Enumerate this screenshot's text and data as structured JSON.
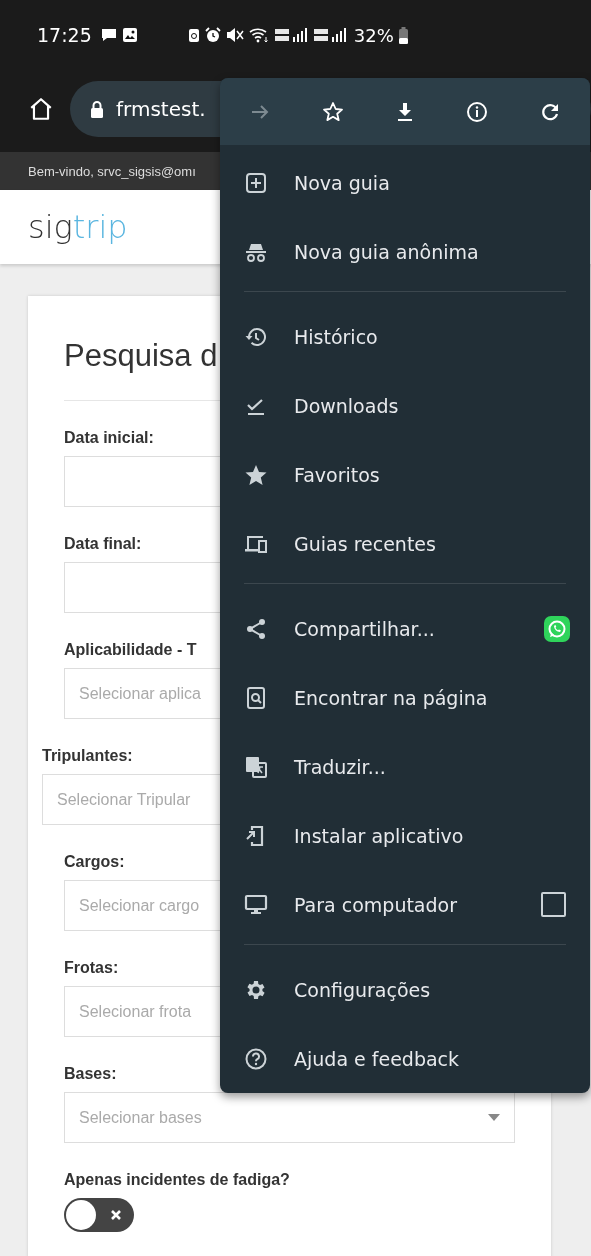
{
  "status_bar": {
    "time": "17:25",
    "battery": "32%"
  },
  "address_bar": {
    "url": "frmstest."
  },
  "welcome": "Bem-vindo, srvc_sigsis@omı",
  "logo": {
    "part1": "sig",
    "part2": "trip"
  },
  "form": {
    "title": "Pesquisa d",
    "fields": [
      {
        "label": "Data inicial:",
        "kind": "date",
        "indented": true
      },
      {
        "label": "Data final:",
        "kind": "date",
        "indented": true
      },
      {
        "label": "Aplicabilidade - T",
        "placeholder": "Selecionar aplica",
        "kind": "select",
        "indented": true
      },
      {
        "label": "Tripulantes:",
        "placeholder": "Selecionar Tripular",
        "kind": "select",
        "indented": false
      },
      {
        "label": "Cargos:",
        "placeholder": "Selecionar cargo",
        "kind": "select",
        "indented": true
      },
      {
        "label": "Frotas:",
        "placeholder": "Selecionar frota",
        "kind": "select",
        "indented": true
      },
      {
        "label": "Bases:",
        "placeholder": "Selecionar bases",
        "kind": "dropdown",
        "indented": true
      }
    ],
    "toggle": {
      "label": "Apenas incidentes de fadiga?",
      "on": false
    }
  },
  "menu": {
    "toolbar": [
      {
        "disabled": true
      },
      {
        "disabled": false
      },
      {
        "disabled": false
      },
      {
        "disabled": false
      },
      {
        "disabled": false
      }
    ],
    "sections": [
      [
        {
          "label": "Nova guia",
          "kind": "plain"
        },
        {
          "label": "Nova guia anônima",
          "kind": "plain"
        }
      ],
      [
        {
          "label": "Histórico",
          "kind": "plain"
        },
        {
          "label": "Downloads",
          "kind": "plain"
        },
        {
          "label": "Favoritos",
          "kind": "plain"
        },
        {
          "label": "Guias recentes",
          "kind": "plain"
        }
      ],
      [
        {
          "label": "Compartilhar...",
          "kind": "share"
        },
        {
          "label": "Encontrar na página",
          "kind": "plain"
        },
        {
          "label": "Traduzir...",
          "kind": "plain"
        },
        {
          "label": "Instalar aplicativo",
          "kind": "plain"
        },
        {
          "label": "Para computador",
          "kind": "checkbox",
          "checked": false
        }
      ],
      [
        {
          "label": "Configurações",
          "kind": "plain"
        },
        {
          "label": "Ajuda e feedback",
          "kind": "plain"
        }
      ]
    ]
  }
}
